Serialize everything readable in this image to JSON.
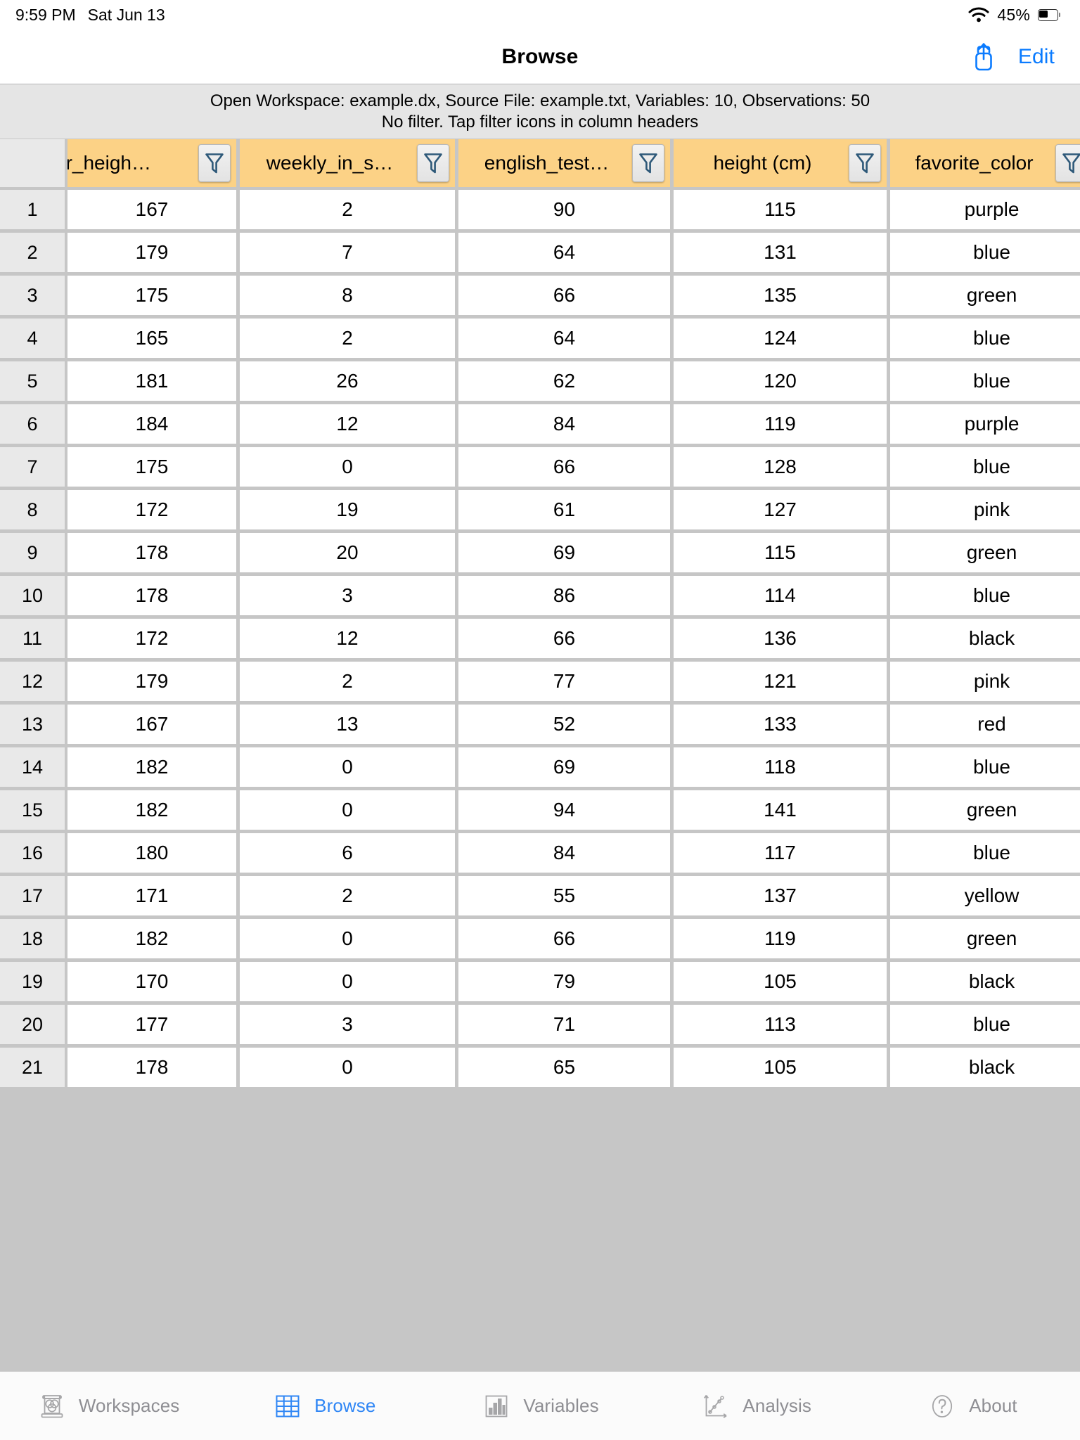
{
  "status_bar": {
    "time": "9:59 PM",
    "date": "Sat Jun 13",
    "wifi_icon": "wifi-icon",
    "battery_percent": "45%",
    "battery_icon": "battery-icon"
  },
  "nav_bar": {
    "title": "Browse",
    "share_icon": "share-icon",
    "edit_label": "Edit"
  },
  "info_banner": {
    "line1": "Open Workspace: example.dx, Source File: example.txt, Variables: 10, Observations: 50",
    "line2": "No filter. Tap filter icons in column headers"
  },
  "table": {
    "row_number_header": "",
    "columns": [
      {
        "label": "er_heigh…",
        "clipped": true,
        "filter_icon": "filter-icon"
      },
      {
        "label": "weekly_in_s…",
        "clipped": false,
        "filter_icon": "filter-icon"
      },
      {
        "label": "english_test…",
        "clipped": false,
        "filter_icon": "filter-icon"
      },
      {
        "label": "height (cm)",
        "clipped": false,
        "filter_icon": "filter-icon"
      },
      {
        "label": "favorite_color",
        "clipped": false,
        "filter_icon": "filter-icon"
      }
    ],
    "rows": [
      {
        "n": "1",
        "cells": [
          "167",
          "2",
          "90",
          "115",
          "purple"
        ]
      },
      {
        "n": "2",
        "cells": [
          "179",
          "7",
          "64",
          "131",
          "blue"
        ]
      },
      {
        "n": "3",
        "cells": [
          "175",
          "8",
          "66",
          "135",
          "green"
        ]
      },
      {
        "n": "4",
        "cells": [
          "165",
          "2",
          "64",
          "124",
          "blue"
        ]
      },
      {
        "n": "5",
        "cells": [
          "181",
          "26",
          "62",
          "120",
          "blue"
        ]
      },
      {
        "n": "6",
        "cells": [
          "184",
          "12",
          "84",
          "119",
          "purple"
        ]
      },
      {
        "n": "7",
        "cells": [
          "175",
          "0",
          "66",
          "128",
          "blue"
        ]
      },
      {
        "n": "8",
        "cells": [
          "172",
          "19",
          "61",
          "127",
          "pink"
        ]
      },
      {
        "n": "9",
        "cells": [
          "178",
          "20",
          "69",
          "115",
          "green"
        ]
      },
      {
        "n": "10",
        "cells": [
          "178",
          "3",
          "86",
          "114",
          "blue"
        ]
      },
      {
        "n": "11",
        "cells": [
          "172",
          "12",
          "66",
          "136",
          "black"
        ]
      },
      {
        "n": "12",
        "cells": [
          "179",
          "2",
          "77",
          "121",
          "pink"
        ]
      },
      {
        "n": "13",
        "cells": [
          "167",
          "13",
          "52",
          "133",
          "red"
        ]
      },
      {
        "n": "14",
        "cells": [
          "182",
          "0",
          "69",
          "118",
          "blue"
        ]
      },
      {
        "n": "15",
        "cells": [
          "182",
          "0",
          "94",
          "141",
          "green"
        ]
      },
      {
        "n": "16",
        "cells": [
          "180",
          "6",
          "84",
          "117",
          "blue"
        ]
      },
      {
        "n": "17",
        "cells": [
          "171",
          "2",
          "55",
          "137",
          "yellow"
        ]
      },
      {
        "n": "18",
        "cells": [
          "182",
          "0",
          "66",
          "119",
          "green"
        ]
      },
      {
        "n": "19",
        "cells": [
          "170",
          "0",
          "79",
          "105",
          "black"
        ]
      },
      {
        "n": "20",
        "cells": [
          "177",
          "3",
          "71",
          "113",
          "blue"
        ]
      },
      {
        "n": "21",
        "cells": [
          "178",
          "0",
          "65",
          "105",
          "black"
        ]
      }
    ]
  },
  "tab_bar": {
    "items": [
      {
        "label": "Workspaces",
        "icon": "workspaces-icon",
        "active": false
      },
      {
        "label": "Browse",
        "icon": "grid-table-icon",
        "active": true
      },
      {
        "label": "Variables",
        "icon": "bar-chart-icon",
        "active": false
      },
      {
        "label": "Analysis",
        "icon": "scatter-plot-icon",
        "active": false
      },
      {
        "label": "About",
        "icon": "question-mark-icon",
        "active": false
      }
    ]
  },
  "colors": {
    "header_background": "#fcd286",
    "accent_blue": "#0a7bff",
    "tab_active": "#2f86f5",
    "tab_inactive": "#8e8e93",
    "banner_background": "#e5e5e5",
    "grid_line": "#c6c6c6"
  }
}
